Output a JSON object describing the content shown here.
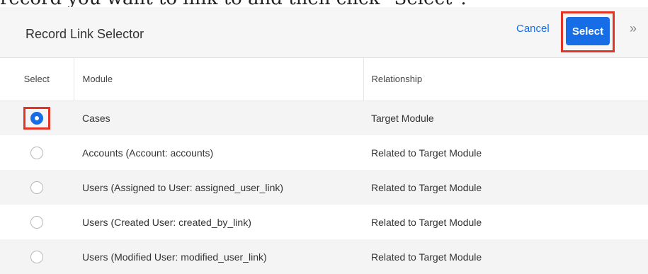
{
  "instruction": "record you want to link to and then click \"Select\".",
  "header": {
    "title": "Record Link Selector",
    "cancel_label": "Cancel",
    "select_label": "Select",
    "expand_glyph": "»"
  },
  "table": {
    "columns": [
      "Select",
      "Module",
      "Relationship"
    ],
    "rows": [
      {
        "module": "Cases",
        "relationship": "Target Module",
        "selected": true
      },
      {
        "module": "Accounts (Account: accounts)",
        "relationship": "Related to Target Module",
        "selected": false
      },
      {
        "module": "Users (Assigned to User: assigned_user_link)",
        "relationship": "Related to Target Module",
        "selected": false
      },
      {
        "module": "Users (Created User: created_by_link)",
        "relationship": "Related to Target Module",
        "selected": false
      },
      {
        "module": "Users (Modified User: modified_user_link)",
        "relationship": "Related to Target Module",
        "selected": false
      }
    ]
  },
  "colors": {
    "accent": "#176de5",
    "highlight": "#e23324",
    "header_bg": "#f6f6f6",
    "row_alt_bg": "#f4f4f4"
  },
  "icons": {
    "expand": "double-chevron-right-icon",
    "radio_on": "radio-checked-icon",
    "radio_off": "radio-unchecked-icon"
  }
}
